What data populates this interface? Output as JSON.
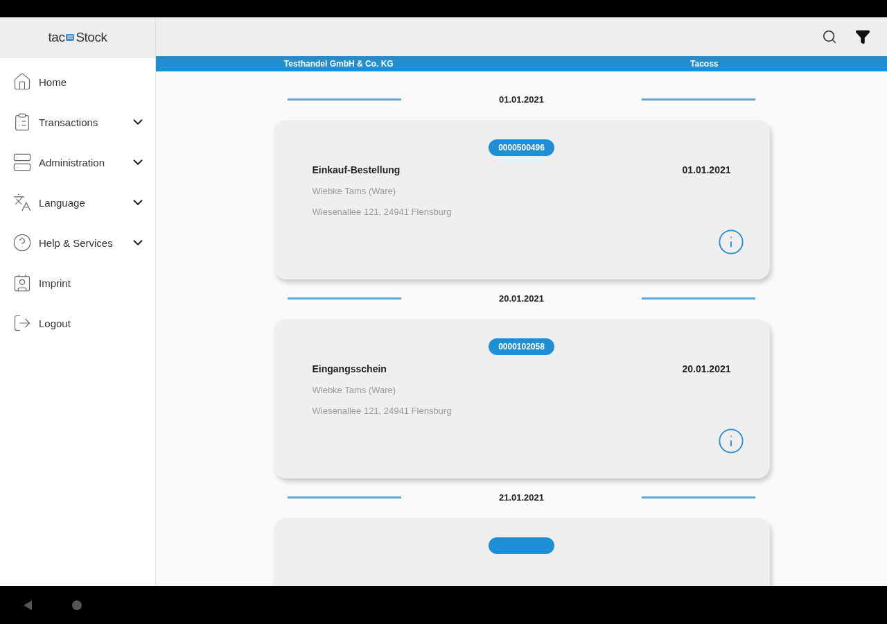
{
  "logo": {
    "prefix": "tac",
    "suffix": "Stock"
  },
  "sidebar": {
    "items": [
      {
        "label": "Home",
        "expandable": false
      },
      {
        "label": "Transactions",
        "expandable": true,
        "expanded": false
      },
      {
        "label": "Administration",
        "expandable": true,
        "expanded": false
      },
      {
        "label": "Language",
        "expandable": true,
        "expanded": false
      },
      {
        "label": "Help & Services",
        "expandable": true,
        "expanded": false
      },
      {
        "label": "Imprint",
        "expandable": false
      },
      {
        "label": "Logout",
        "expandable": false
      }
    ]
  },
  "info_bar": {
    "company": "Testhandel GmbH & Co. KG",
    "user": "Tacoss"
  },
  "groups": [
    {
      "date": "01.01.2021",
      "card": {
        "number": "0000500496",
        "title": "Einkauf-Bestellung",
        "date": "01.01.2021",
        "name": "Wiebke Tams (Ware)",
        "address": "Wiesenallee 121, 24941 Flensburg"
      }
    },
    {
      "date": "20.01.2021",
      "card": {
        "number": "0000102058",
        "title": "Eingangsschein",
        "date": "20.01.2021",
        "name": "Wiebke Tams (Ware)",
        "address": "Wiesenallee 121, 24941 Flensburg"
      }
    },
    {
      "date": "21.01.2021",
      "card": {
        "cut": true
      }
    }
  ]
}
